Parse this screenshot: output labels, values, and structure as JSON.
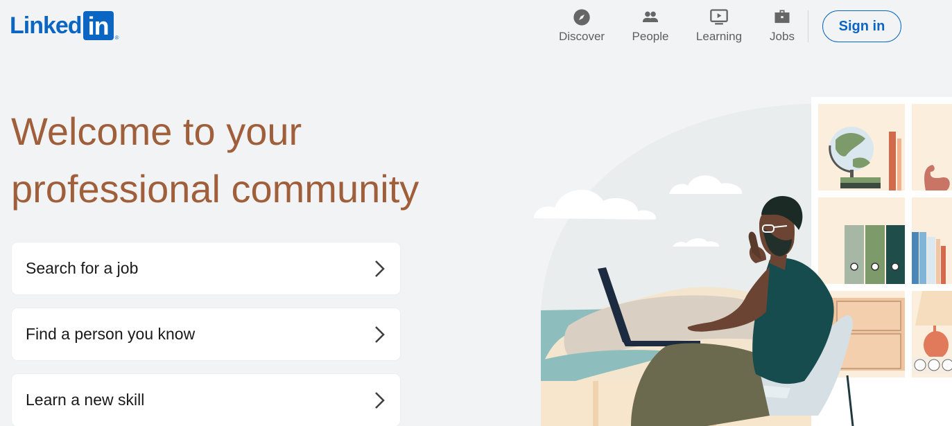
{
  "brand": {
    "name_part": "Linked",
    "box_part": "in",
    "registered": "®"
  },
  "nav": [
    {
      "label": "Discover",
      "icon": "compass-icon"
    },
    {
      "label": "People",
      "icon": "people-icon"
    },
    {
      "label": "Learning",
      "icon": "video-play-icon"
    },
    {
      "label": "Jobs",
      "icon": "briefcase-icon"
    }
  ],
  "signin_label": "Sign in",
  "hero": {
    "line1": "Welcome to your",
    "line2": "professional community"
  },
  "actions": [
    {
      "label": "Search for a job"
    },
    {
      "label": "Find a person you know"
    },
    {
      "label": "Learn a new skill"
    }
  ],
  "colors": {
    "brand_blue": "#0a66c2",
    "headline": "#a05f3b",
    "page_bg": "#f2f3f5"
  }
}
